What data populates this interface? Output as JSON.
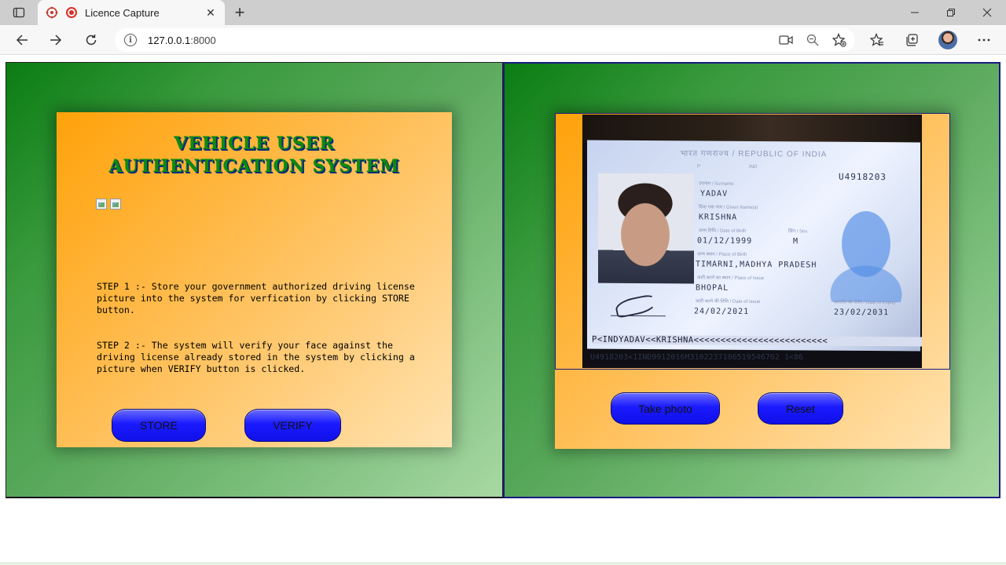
{
  "browser": {
    "tab_title": "Licence Capture",
    "tab_close_icon": "close-icon",
    "new_tab_icon": "plus-icon",
    "url": "127.0.0.1:8000",
    "url_host": "127.0.0.1",
    "url_port": ":8000"
  },
  "left_card": {
    "heading": "VEHICLE USER AUTHENTICATION SYSTEM",
    "step1": "STEP 1 :- Store your government authorized driving license picture into the system for verfication by clicking STORE button.",
    "step2": "STEP 2 :- The system will verify your face against the driving license already stored in the system by clicking a picture when VERIFY button is clicked.",
    "store_label": "STORE",
    "verify_label": "VERIFY"
  },
  "right_card": {
    "take_photo_label": "Take photo",
    "reset_label": "Reset"
  },
  "licence": {
    "header": "भारत गणराज्य / REPUBLIC OF INDIA",
    "number": "U4918203",
    "type": "P",
    "code": "IND",
    "surname_label": "उपनाम / Surname",
    "surname": "YADAV",
    "given_label": "दिया गया नाम / Given Name(s)",
    "given": "KRISHNA",
    "dob_label": "जन्म तिथि / Date of Birth",
    "dob": "01/12/1999",
    "sex_label": "लिंग / Sex",
    "sex": "M",
    "pob_label": "जन्म स्थान / Place of Birth",
    "pob": "TIMARNI,MADHYA PRADESH",
    "poi_label": "जारी करने का स्थान / Place of Issue",
    "poi": "BHOPAL",
    "doi_label": "जारी करने की तिथि / Date of Issue",
    "doi": "24/02/2021",
    "doe_label": "समाप्ति की तिथि / Date of Expiry",
    "doe": "23/02/2031",
    "mrz_line1": "P<INDYADAV<<KRISHNA<<<<<<<<<<<<<<<<<<<<<<<<<",
    "mrz_line2": "U4918203<1IND9912016M3102237106519546762 1<86"
  },
  "colors": {
    "panel_green": "#0a7d12",
    "card_orange": "#ffa20a",
    "button_blue": "#1a1aff",
    "heading_green": "#0e8a0e"
  }
}
